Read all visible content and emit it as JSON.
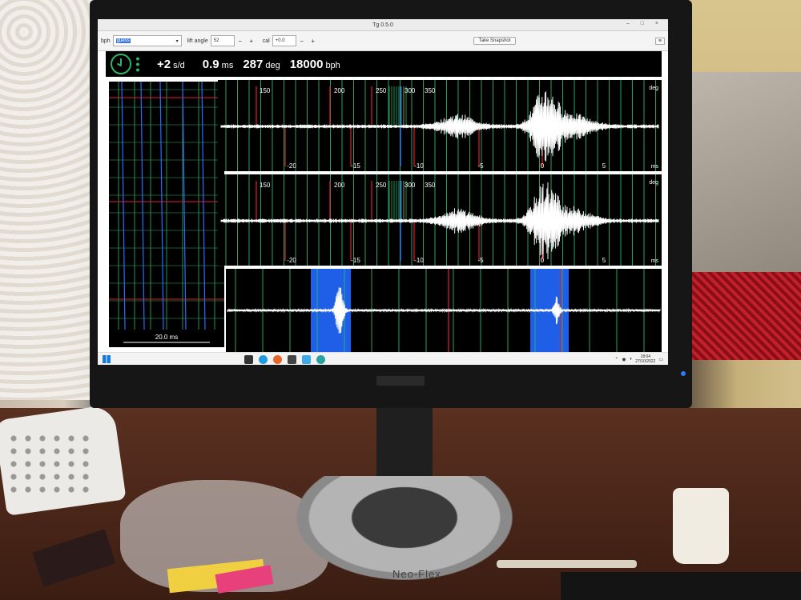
{
  "app": {
    "title": "Tg 0.5.0",
    "window_controls": "– □ ×"
  },
  "toolbar": {
    "bph_label": "bph",
    "bph_value": "guess",
    "lift_angle_label": "lift angle",
    "lift_angle_value": "52",
    "cal_label": "cal",
    "cal_value": "+0.0",
    "minus": "−",
    "plus": "+",
    "snapshot_label": "Take Snapshot",
    "menu_label": "≡"
  },
  "metrics": {
    "rate_value": "+2",
    "rate_unit": "s/d",
    "beat_error_value": "0.9",
    "beat_error_unit": "ms",
    "amplitude_value": "287",
    "amplitude_unit": "deg",
    "bph_value": "18000",
    "bph_unit": "bph"
  },
  "paper_strip": {
    "scale_label": "20.0 ms"
  },
  "traces": {
    "deg_ticks": [
      "150",
      "200",
      "250",
      "300",
      "350"
    ],
    "ms_ticks": [
      "-20",
      "-15",
      "-10",
      "-5",
      "0",
      "5"
    ],
    "deg_unit": "deg",
    "ms_unit": "ms"
  },
  "taskbar": {
    "time": "18:04",
    "date": "27/10/2022"
  },
  "physical": {
    "stand_brand": "Neo-Flex"
  },
  "colors": {
    "signal": "#ffffff",
    "grid_green": "#2fb36b",
    "marker_red": "#e0202a",
    "marker_blue": "#2a6cff",
    "highlight_blue": "#1f5fe8"
  }
}
